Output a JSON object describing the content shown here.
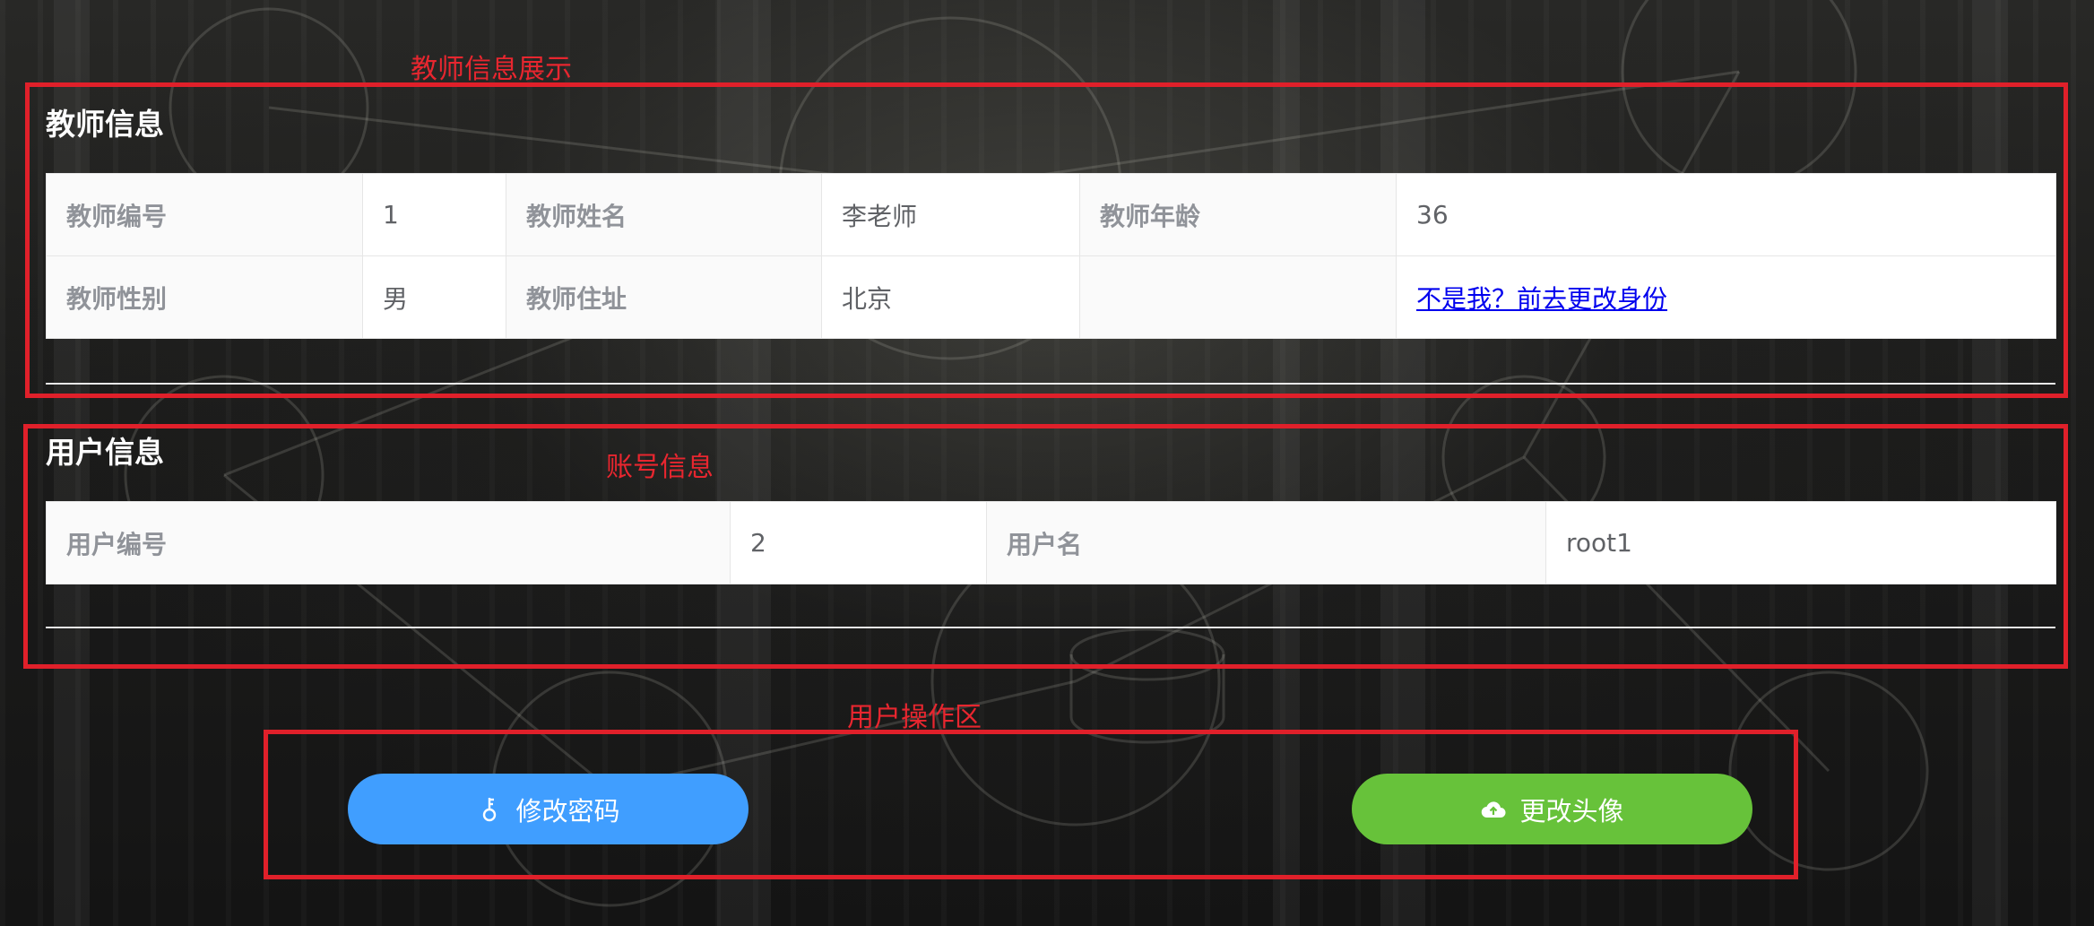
{
  "annotations": {
    "teacher_section": "教师信息展示",
    "account_section": "账号信息",
    "operation_section": "用户操作区"
  },
  "teacher_info": {
    "title": "教师信息",
    "rows": [
      [
        {
          "label": "教师编号",
          "value": "1"
        },
        {
          "label": "教师姓名",
          "value": "李老师"
        },
        {
          "label": "教师年龄",
          "value": "36"
        }
      ],
      [
        {
          "label": "教师性别",
          "value": "男"
        },
        {
          "label": "教师住址",
          "value": "北京"
        },
        {
          "label": "",
          "value": "不是我？前去更改身份"
        }
      ]
    ]
  },
  "user_info": {
    "title": "用户信息",
    "rows": [
      [
        {
          "label": "用户编号",
          "value": "2"
        },
        {
          "label": "用户名",
          "value": "root1"
        }
      ]
    ]
  },
  "actions": {
    "change_password": {
      "label": "修改密码",
      "icon": "key-icon",
      "color": "#409eff"
    },
    "change_avatar": {
      "label": "更改头像",
      "icon": "cloud-upload-icon",
      "color": "#67c23a"
    }
  },
  "colors": {
    "annotation_red": "#e0202a",
    "label_gray": "#909399",
    "value_gray": "#606266",
    "link_blue": "#0000ee"
  }
}
